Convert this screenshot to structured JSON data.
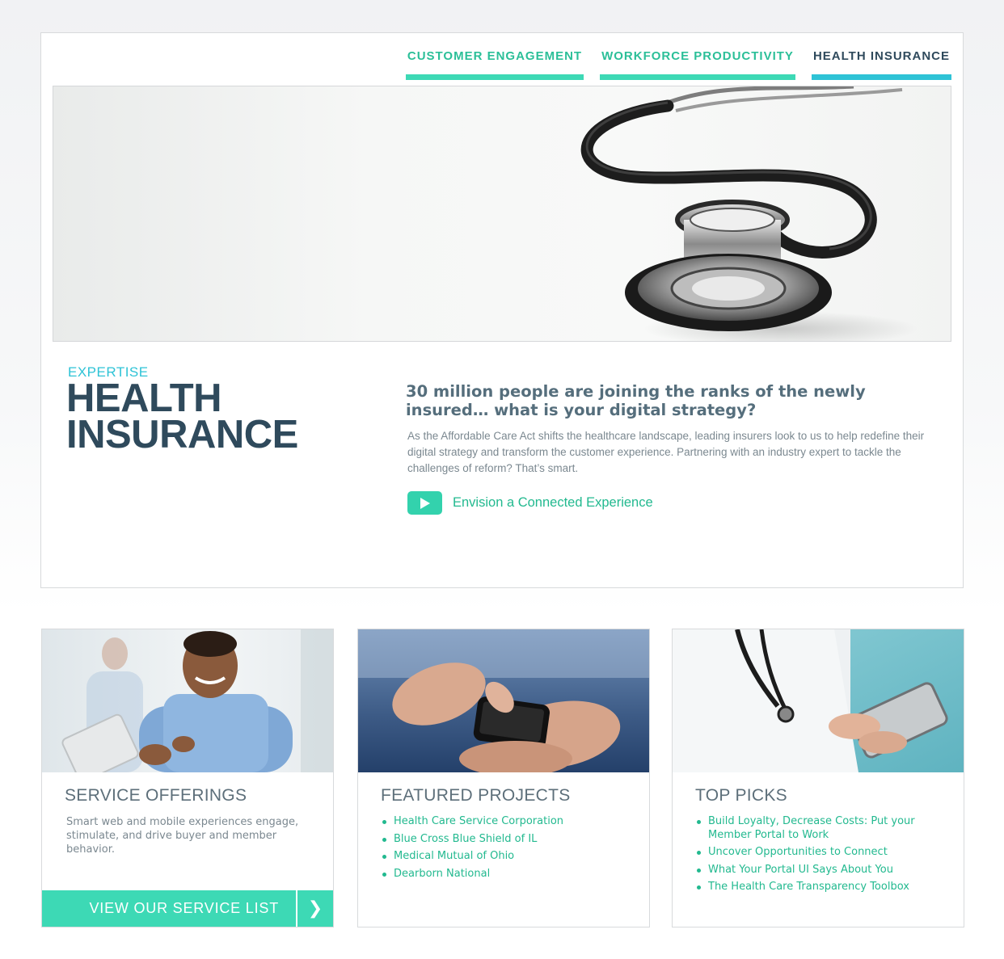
{
  "nav": {
    "tabs": [
      {
        "label": "CUSTOMER ENGAGEMENT",
        "active": false
      },
      {
        "label": "WORKFORCE PRODUCTIVITY",
        "active": false
      },
      {
        "label": "HEALTH INSURANCE",
        "active": true
      }
    ]
  },
  "hero": {
    "image": "stethoscope-photo"
  },
  "intro": {
    "eyebrow": "EXPERTISE",
    "title": "HEALTH INSURANCE",
    "headline": "30 million people are joining the ranks of the newly insured… what is your digital strategy?",
    "body": "As the Affordable Care Act shifts the healthcare landscape, leading insurers look to us to help redefine their digital strategy and transform the customer experience. Partnering with an industry expert to tackle the challenges of reform? That’s smart.",
    "video_link": "Envision a Connected Experience",
    "video_icon": "play-icon"
  },
  "cards": {
    "services": {
      "image": "man-with-tablet-photo",
      "title": "SERVICE OFFERINGS",
      "description": "Smart web and mobile experiences engage, stimulate, and drive buyer and member behavior.",
      "cta_label": "VIEW OUR SERVICE LIST",
      "cta_arrow": "❯"
    },
    "projects": {
      "image": "hands-smartphone-photo",
      "title": "FEATURED PROJECTS",
      "items": [
        "Health Care Service Corporation",
        "Blue Cross Blue Shield of IL",
        "Medical Mutual of Ohio",
        "Dearborn National"
      ]
    },
    "picks": {
      "image": "doctor-with-tablet-photo",
      "title": "TOP PICKS",
      "items": [
        "Build Loyalty, Decrease Costs: Put your Member Portal to Work",
        "Uncover Opportunities to Connect",
        "What Your Portal UI Says About You",
        "The Health Care Transparency Toolbox"
      ]
    }
  },
  "colors": {
    "accent": "#3dd9b5",
    "active_tab": "#2ec3d6",
    "heading": "#2f4a5c",
    "link": "#22b98f"
  }
}
